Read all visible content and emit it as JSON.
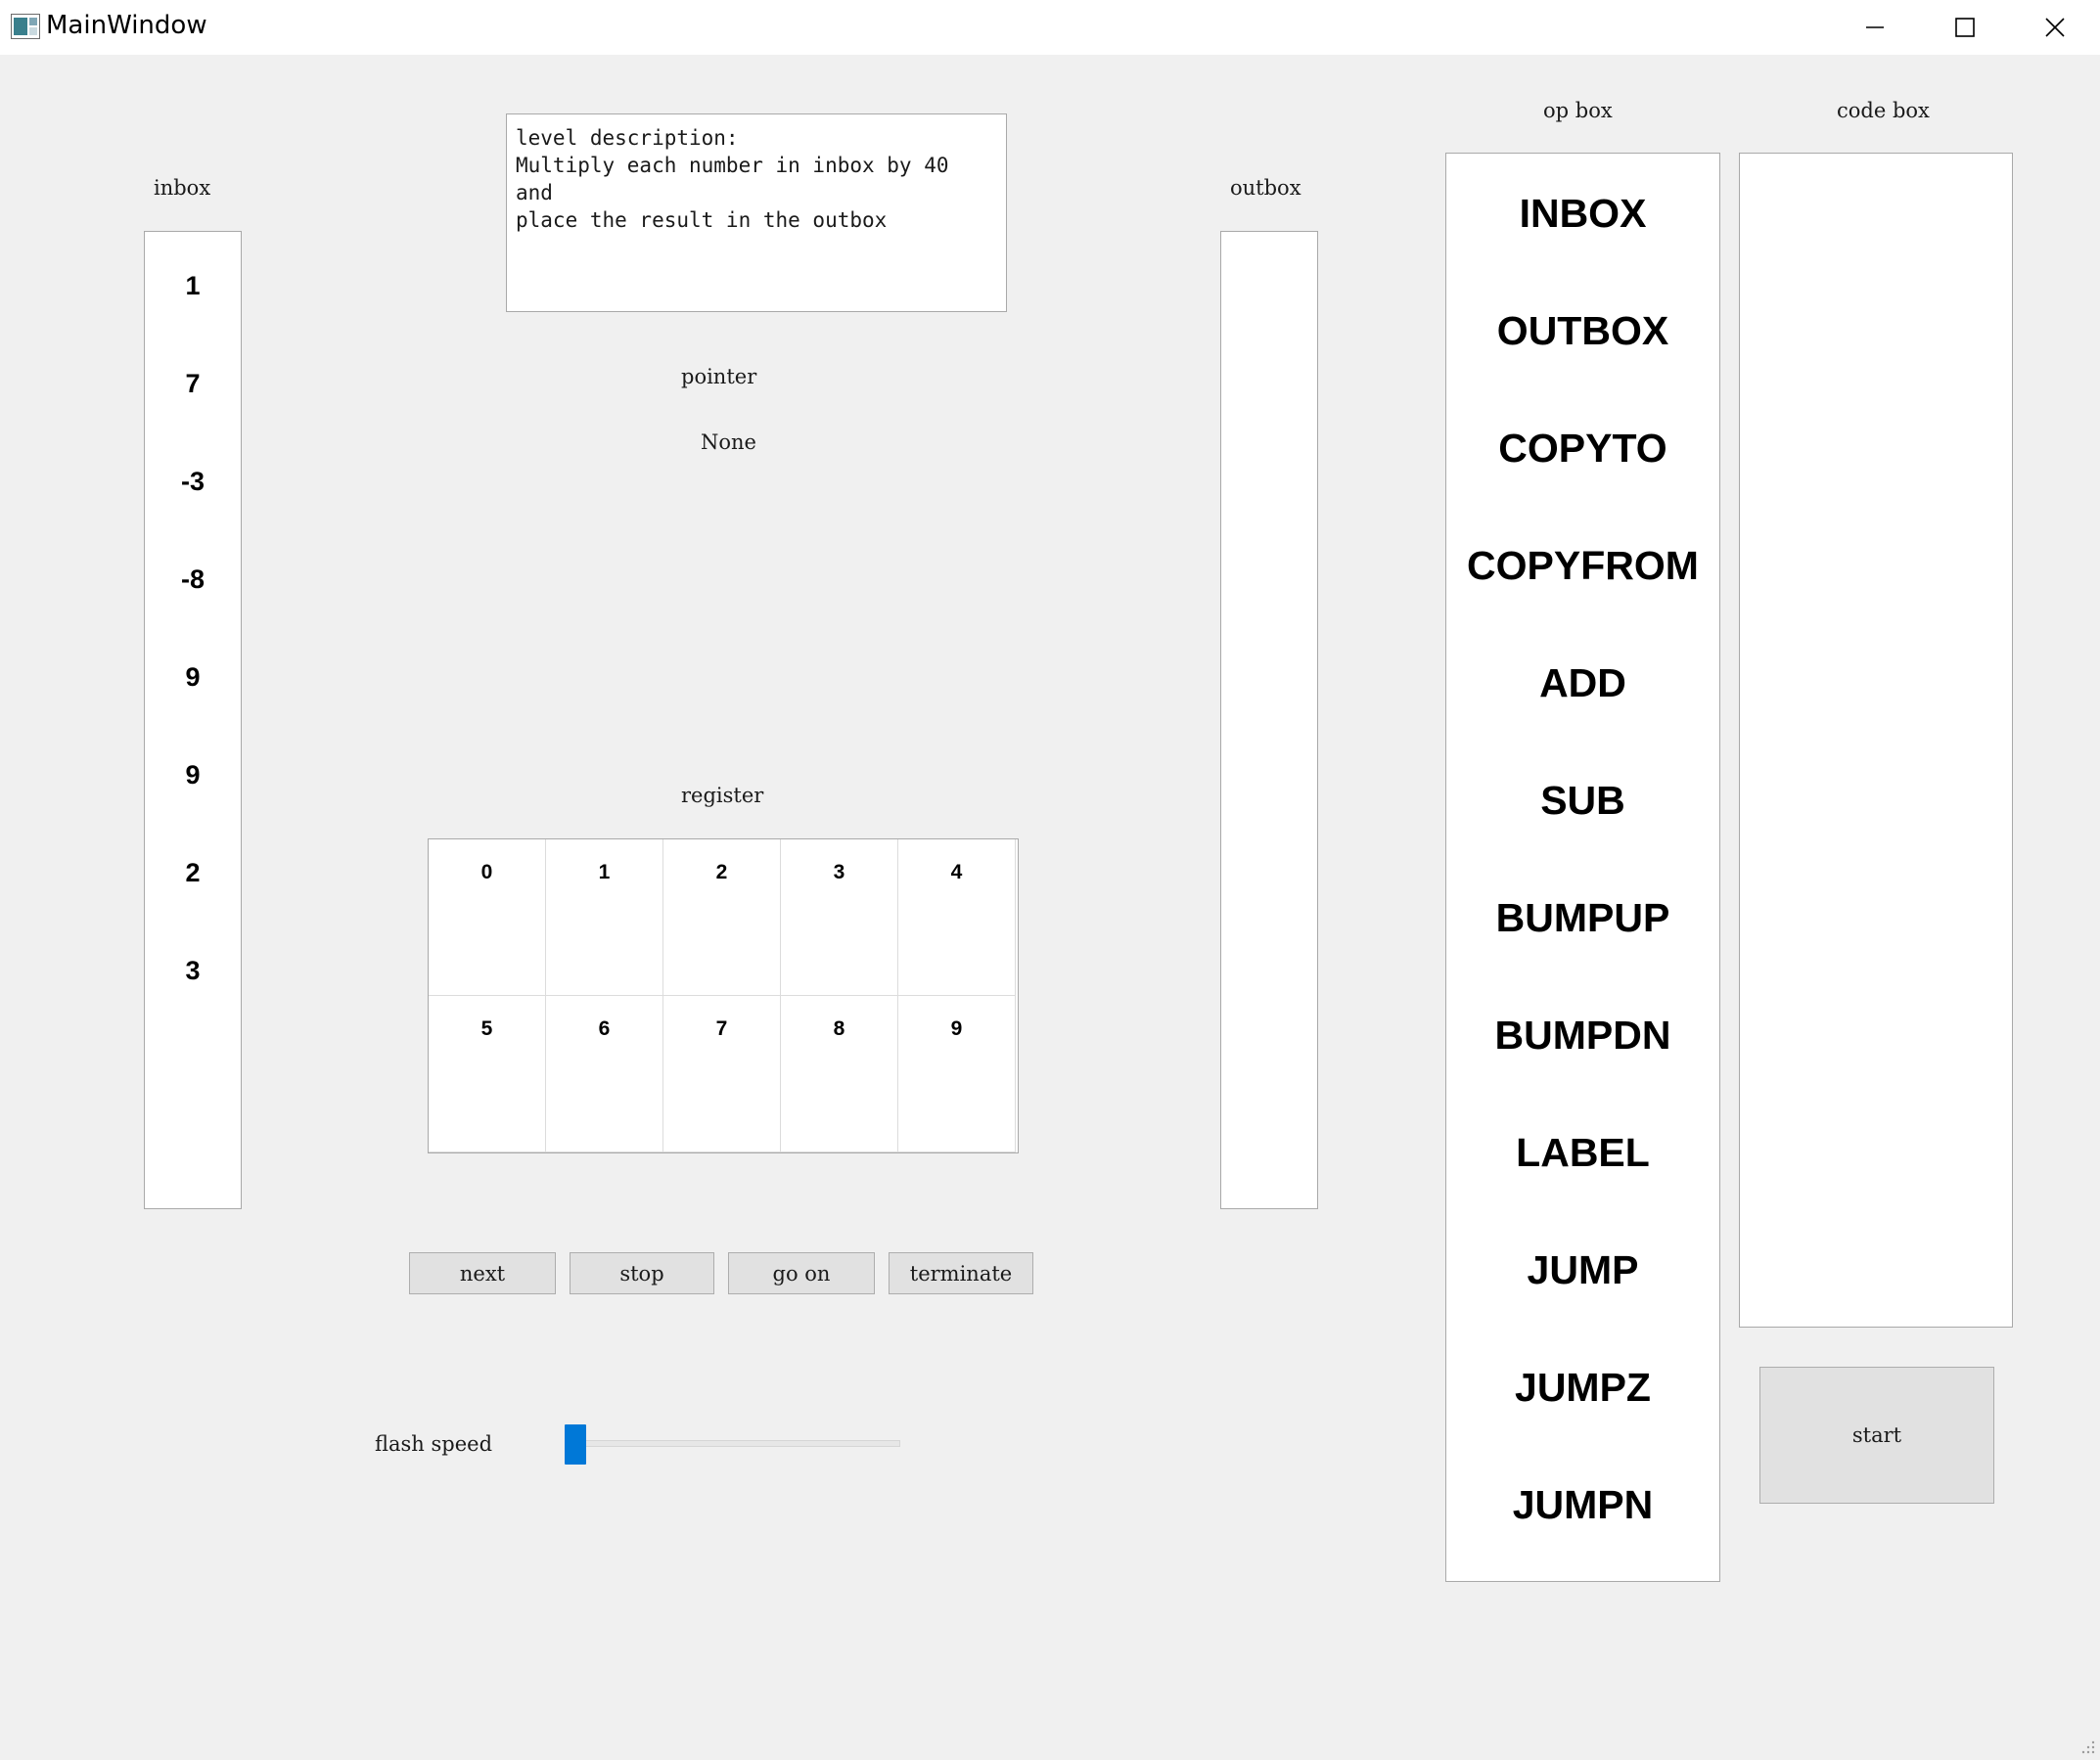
{
  "window": {
    "title": "MainWindow",
    "icon": "app-icon",
    "controls": [
      "minimize-icon",
      "maximize-icon",
      "close-icon"
    ]
  },
  "inbox": {
    "label": "inbox",
    "items": [
      "1",
      "7",
      "-3",
      "-8",
      "9",
      "9",
      "2",
      "3"
    ]
  },
  "description": {
    "text": "level description:\nMultiply each number in inbox by 40 and\nplace the result in the outbox"
  },
  "pointer": {
    "label": "pointer",
    "value": "None"
  },
  "register": {
    "label": "register",
    "cells": [
      "0",
      "1",
      "2",
      "3",
      "4",
      "5",
      "6",
      "7",
      "8",
      "9"
    ]
  },
  "outbox": {
    "label": "outbox",
    "items": []
  },
  "op_box": {
    "label": "op box",
    "ops": [
      "INBOX",
      "OUTBOX",
      "COPYTO",
      "COPYFROM",
      "ADD",
      "SUB",
      "BUMPUP",
      "BUMPDN",
      "LABEL",
      "JUMP",
      "JUMPZ",
      "JUMPN"
    ]
  },
  "code_box": {
    "label": "code box",
    "lines": []
  },
  "controls": {
    "next": "next",
    "stop": "stop",
    "go_on": "go on",
    "terminate": "terminate",
    "start": "start"
  },
  "flash_speed": {
    "label": "flash speed",
    "value_fraction": 0.0
  },
  "colors": {
    "accent": "#0078d7",
    "background": "#f0f0f0",
    "panel": "#ffffff"
  }
}
